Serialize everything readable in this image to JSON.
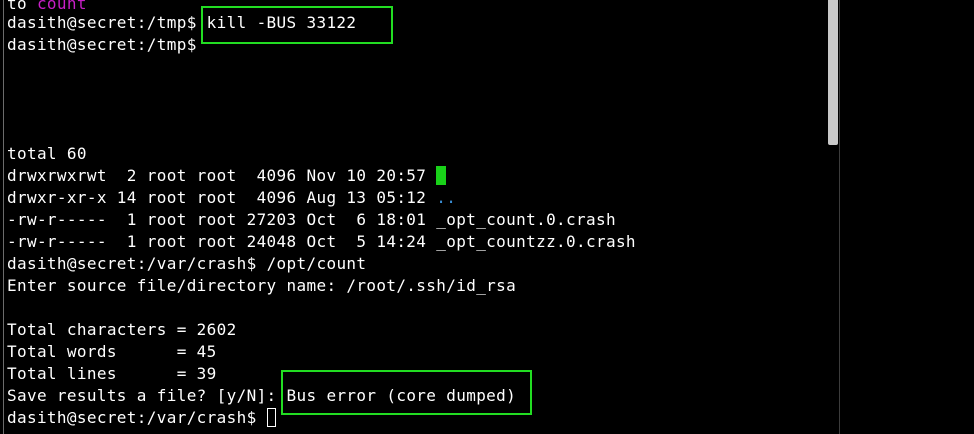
{
  "terminal": {
    "lines": [
      {
        "text": "to ",
        "accent": "count"
      },
      {
        "prompt": "dasith@secret:/tmp$ ",
        "command": "kill -BUS 33122"
      },
      {
        "prompt": "dasith@secret:/tmp$ "
      },
      {
        "text": "total 60"
      },
      {
        "text": "drwxrwxrwt  2 root root  4096 Nov 10 20:57 ",
        "dir": "."
      },
      {
        "text": "drwxr-xr-x 14 root root  4096 Aug 13 05:12 ",
        "dir": ".."
      },
      {
        "text": "-rw-r-----  1 root root 27203 Oct  6 18:01 _opt_count.0.crash"
      },
      {
        "text": "-rw-r-----  1 root root 24048 Oct  5 14:24 _opt_countzz.0.crash"
      },
      {
        "prompt": "dasith@secret:/var/crash$ ",
        "command": "/opt/count"
      },
      {
        "text": "Enter source file/directory name: /root/.ssh/id_rsa"
      },
      {
        "text": ""
      },
      {
        "text": "Total characters = 2602"
      },
      {
        "text": "Total words      = 45"
      },
      {
        "text": "Total lines      = 39"
      },
      {
        "text": "Save results a file? [y/N]: ",
        "error": "Bus error (core dumped)"
      },
      {
        "prompt": "dasith@secret:/var/crash$ "
      }
    ]
  },
  "colors": {
    "background": "#000000",
    "text": "#ffffff",
    "highlight_box": "#22dd22",
    "dir_color": "#3a8fd6",
    "accent_magenta": "#c71fc7"
  }
}
